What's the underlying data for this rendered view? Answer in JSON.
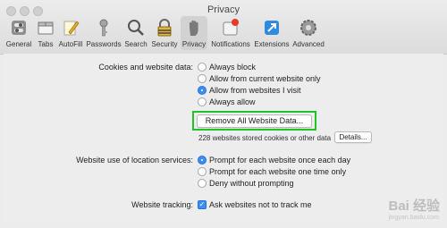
{
  "window": {
    "title": "Privacy"
  },
  "toolbar": {
    "items": [
      {
        "label": "General",
        "icon": "switch-icon"
      },
      {
        "label": "Tabs",
        "icon": "tabs-icon"
      },
      {
        "label": "AutoFill",
        "icon": "pencil-icon"
      },
      {
        "label": "Passwords",
        "icon": "key-icon"
      },
      {
        "label": "Search",
        "icon": "magnifier-icon"
      },
      {
        "label": "Security",
        "icon": "lock-icon"
      },
      {
        "label": "Privacy",
        "icon": "hand-icon",
        "selected": true
      },
      {
        "label": "Notifications",
        "icon": "notification-icon"
      },
      {
        "label": "Extensions",
        "icon": "extensions-icon"
      },
      {
        "label": "Advanced",
        "icon": "gear-icon"
      }
    ]
  },
  "cookies": {
    "label": "Cookies and website data:",
    "options": [
      {
        "label": "Always block",
        "selected": false
      },
      {
        "label": "Allow from current website only",
        "selected": false
      },
      {
        "label": "Allow from websites I visit",
        "selected": true
      },
      {
        "label": "Always allow",
        "selected": false
      }
    ],
    "remove_button": "Remove All Website Data...",
    "stored_text": "228 websites stored cookies or other data",
    "details_button": "Details..."
  },
  "location": {
    "label": "Website use of location services:",
    "options": [
      {
        "label": "Prompt for each website once each day",
        "selected": true
      },
      {
        "label": "Prompt for each website one time only",
        "selected": false
      },
      {
        "label": "Deny without prompting",
        "selected": false
      }
    ]
  },
  "tracking": {
    "label": "Website tracking:",
    "checkbox_label": "Ask websites not to track me",
    "checked": true
  },
  "colors": {
    "accent": "#3b8df5",
    "highlight": "#22c22a"
  },
  "watermark": {
    "text": "Bai 经验",
    "sub": "jingyan.baidu.com"
  }
}
